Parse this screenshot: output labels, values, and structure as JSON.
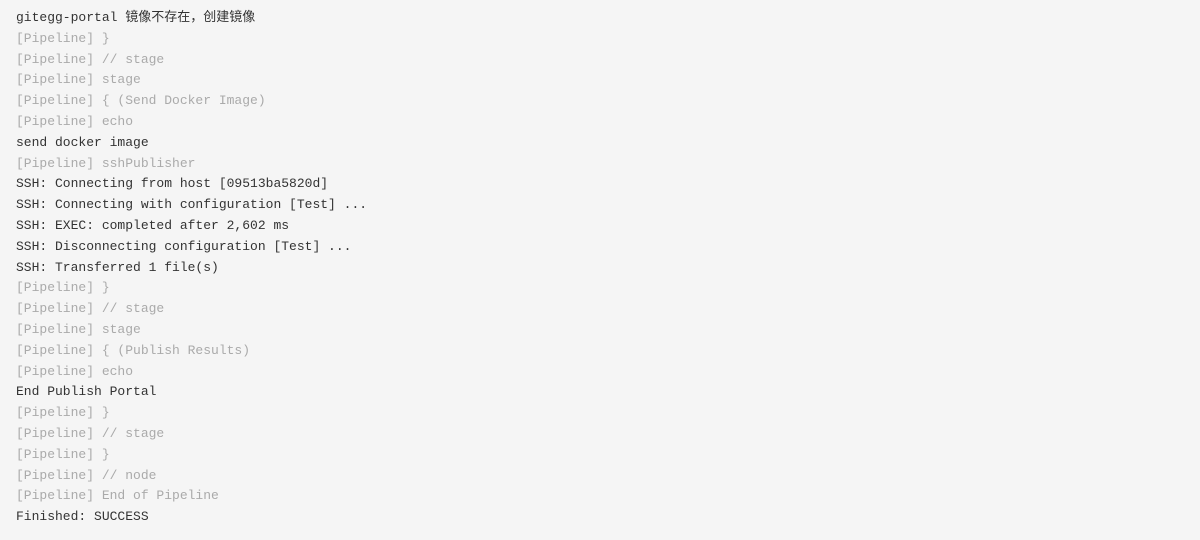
{
  "console": {
    "lines": [
      {
        "text": "gitegg-portal 镜像不存在，创建镜像",
        "type": "normal"
      },
      {
        "text": "[Pipeline] }",
        "type": "pipeline"
      },
      {
        "text": "[Pipeline] // stage",
        "type": "pipeline"
      },
      {
        "text": "[Pipeline] stage",
        "type": "pipeline"
      },
      {
        "text": "[Pipeline] { (Send Docker Image)",
        "type": "pipeline"
      },
      {
        "text": "[Pipeline] echo",
        "type": "pipeline"
      },
      {
        "text": "send docker image",
        "type": "normal"
      },
      {
        "text": "[Pipeline] sshPublisher",
        "type": "pipeline"
      },
      {
        "text": "SSH: Connecting from host [09513ba5820d]",
        "type": "normal"
      },
      {
        "text": "SSH: Connecting with configuration [Test] ...",
        "type": "normal"
      },
      {
        "text": "SSH: EXEC: completed after 2,602 ms",
        "type": "normal"
      },
      {
        "text": "SSH: Disconnecting configuration [Test] ...",
        "type": "normal"
      },
      {
        "text": "SSH: Transferred 1 file(s)",
        "type": "normal"
      },
      {
        "text": "[Pipeline] }",
        "type": "pipeline"
      },
      {
        "text": "[Pipeline] // stage",
        "type": "pipeline"
      },
      {
        "text": "[Pipeline] stage",
        "type": "pipeline"
      },
      {
        "text": "[Pipeline] { (Publish Results)",
        "type": "pipeline"
      },
      {
        "text": "[Pipeline] echo",
        "type": "pipeline"
      },
      {
        "text": "End Publish Portal",
        "type": "normal"
      },
      {
        "text": "[Pipeline] }",
        "type": "pipeline"
      },
      {
        "text": "[Pipeline] // stage",
        "type": "pipeline"
      },
      {
        "text": "[Pipeline] }",
        "type": "pipeline"
      },
      {
        "text": "[Pipeline] // node",
        "type": "pipeline"
      },
      {
        "text": "[Pipeline] End of Pipeline",
        "type": "pipeline"
      },
      {
        "text": "Finished: SUCCESS",
        "type": "normal"
      }
    ]
  }
}
